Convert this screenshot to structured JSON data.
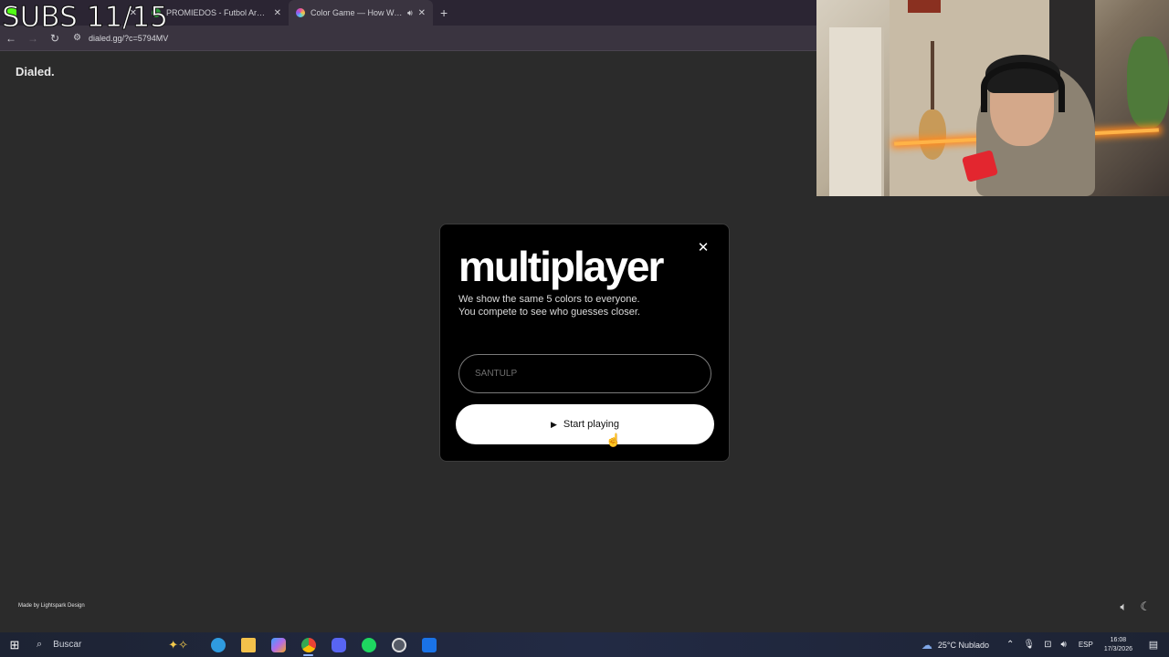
{
  "overlay": {
    "subs_text": "SUBS 11/15"
  },
  "browser": {
    "tabs": [
      {
        "title": "",
        "favicon_color": "#53fc18",
        "active": false
      },
      {
        "title": "PROMIEDOS - Futbol Argentino",
        "favicon_color": "#2e9a3a",
        "active": false
      },
      {
        "title": "Color Game — How Well Ca",
        "favicon_color": "#e84fa0",
        "active": true,
        "audio": true
      }
    ],
    "new_tab_icon": "plus-icon",
    "url": "dialed.gg/?c=5794MV"
  },
  "page": {
    "brand": "Dialed.",
    "made_by": "Made by Lightspark Design"
  },
  "modal": {
    "title": "multiplayer",
    "description_line1": "We show the same 5 colors to everyone.",
    "description_line2": "You compete to see who guesses closer.",
    "name_placeholder": "SANTULP",
    "start_label": "Start playing"
  },
  "taskbar": {
    "search_label": "Buscar",
    "apps": [
      {
        "name": "edge",
        "color": "#2f9be0"
      },
      {
        "name": "file-explorer",
        "color": "#f3c14b"
      },
      {
        "name": "copilot",
        "color": "#b36be8"
      },
      {
        "name": "chrome",
        "color": "#e94235",
        "active": true
      },
      {
        "name": "discord",
        "color": "#5865f2"
      },
      {
        "name": "spotify",
        "color": "#1ed760"
      },
      {
        "name": "obs",
        "color": "#555a66"
      },
      {
        "name": "outlook",
        "color": "#1a73e8"
      }
    ],
    "weather": "25°C  Nublado",
    "language": "ESP",
    "time": "16:08",
    "date": "17/3/2026"
  }
}
